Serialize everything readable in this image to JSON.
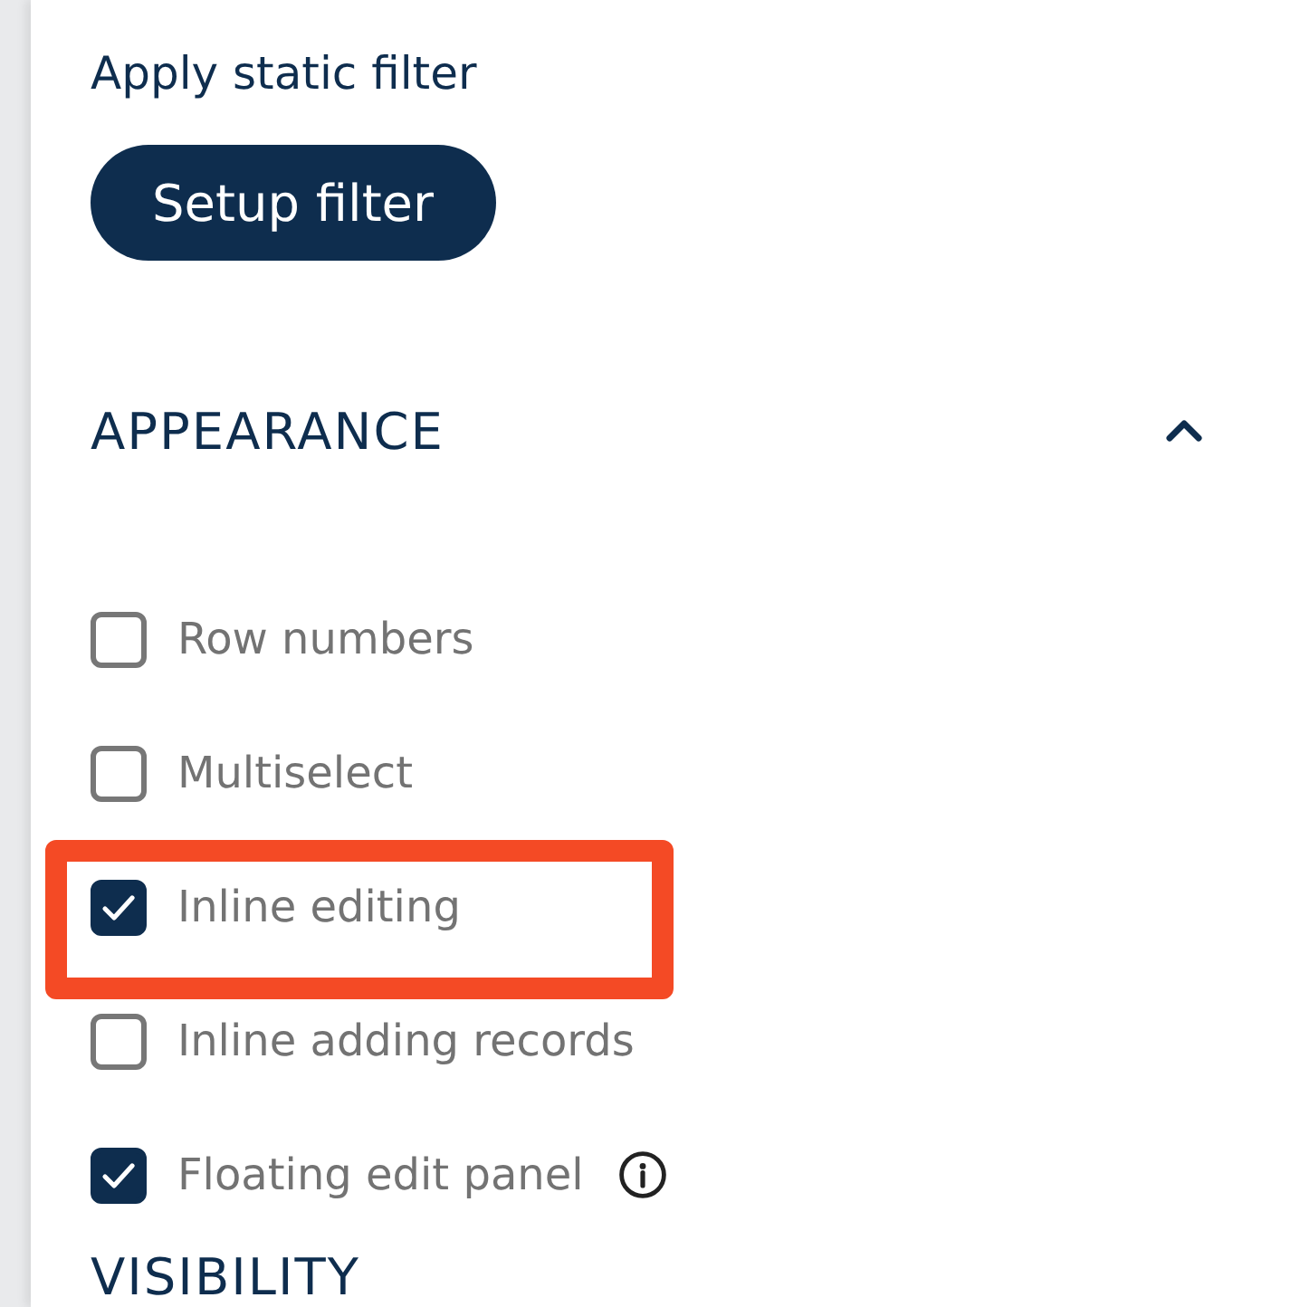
{
  "static_filter": {
    "label": "Apply static filter",
    "button": "Setup filter"
  },
  "sections": [
    {
      "title": "APPEARANCE",
      "expanded": true,
      "options": [
        {
          "label": "Row numbers",
          "checked": false,
          "highlighted": false,
          "has_info": false
        },
        {
          "label": "Multiselect",
          "checked": false,
          "highlighted": false,
          "has_info": false
        },
        {
          "label": "Inline editing",
          "checked": true,
          "highlighted": true,
          "has_info": false
        },
        {
          "label": "Inline adding records",
          "checked": false,
          "highlighted": false,
          "has_info": false
        },
        {
          "label": "Floating edit panel",
          "checked": true,
          "highlighted": false,
          "has_info": true
        }
      ]
    },
    {
      "title": "VISIBILITY"
    }
  ]
}
